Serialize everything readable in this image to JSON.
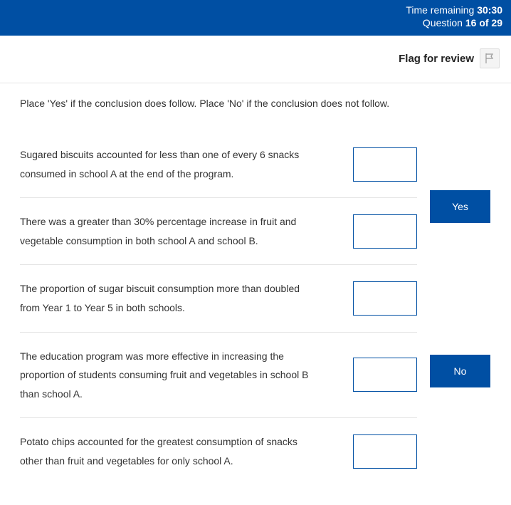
{
  "header": {
    "time_label": "Time remaining",
    "time_value": "30:30",
    "question_label": "Question",
    "question_current": "16",
    "question_of": "of",
    "question_total": "29"
  },
  "flag": {
    "label": "Flag for review"
  },
  "instructions": "Place 'Yes' if the conclusion does follow. Place 'No' if the conclusion does not follow.",
  "statements": [
    {
      "text": "Sugared biscuits accounted for less than one of every 6 snacks consumed in school A at the end of the program."
    },
    {
      "text": "There was a greater than 30% percentage increase in fruit and vegetable consumption in both school A and school B."
    },
    {
      "text": "The proportion of sugar biscuit consumption more than doubled from Year 1 to Year 5 in both schools."
    },
    {
      "text": "The education program was more effective in increasing the proportion of students consuming fruit and vegetables in school B than school A."
    },
    {
      "text": "Potato chips accounted for the greatest consumption of snacks other than fruit and vegetables for only school A."
    }
  ],
  "options": {
    "yes": "Yes",
    "no": "No"
  }
}
